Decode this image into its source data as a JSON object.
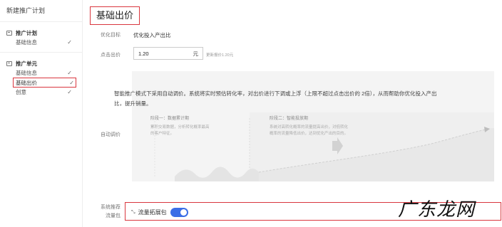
{
  "sidebar": {
    "title": "新建推广计划",
    "plan_section": {
      "label": "推广计划",
      "items": [
        {
          "label": "基础信息",
          "check": "✓"
        }
      ]
    },
    "unit_section": {
      "label": "推广单元",
      "items": [
        {
          "label": "基础信息",
          "check": "✓"
        },
        {
          "label": "基础出价",
          "check": "✓"
        },
        {
          "label": "创意",
          "check": "✓"
        }
      ]
    }
  },
  "main": {
    "page_title": "基础出价",
    "optimize_target": {
      "label": "优化目标",
      "value": "优化投入产出比"
    },
    "click_bid": {
      "label": "点击出价",
      "value": "1.20",
      "unit": "元",
      "hint": "更新报价1.20元"
    },
    "auto_bid": {
      "label": "自动调价",
      "description": "智能推广模式下采用自动调价。系统将实时预估转化率，对出价进行下调或上浮（上限不超过点击出价的 2倍），从而帮助你优化投入产出比，提升销量。",
      "stage1": {
        "title": "阶段一：数据累计期",
        "text": "累积交易数据，分析转化概率最高的客户特征。"
      },
      "stage2": {
        "title": "阶段二：智能投放期",
        "text": "系统对高转化概率的流量提高出价，对低转化概率的流量降低出价，达到优化产出的目的。"
      }
    },
    "traffic_pack": {
      "label_line1": "系统推荐",
      "label_line2": "流量包",
      "toggle_label": "流量拓展包",
      "toggle_on": true,
      "icon": "shrink-icon"
    }
  },
  "watermark": "广东龙网",
  "colors": {
    "highlight": "#d9363e",
    "toggle": "#3b6ee6",
    "panel": "#f4f4f4"
  }
}
